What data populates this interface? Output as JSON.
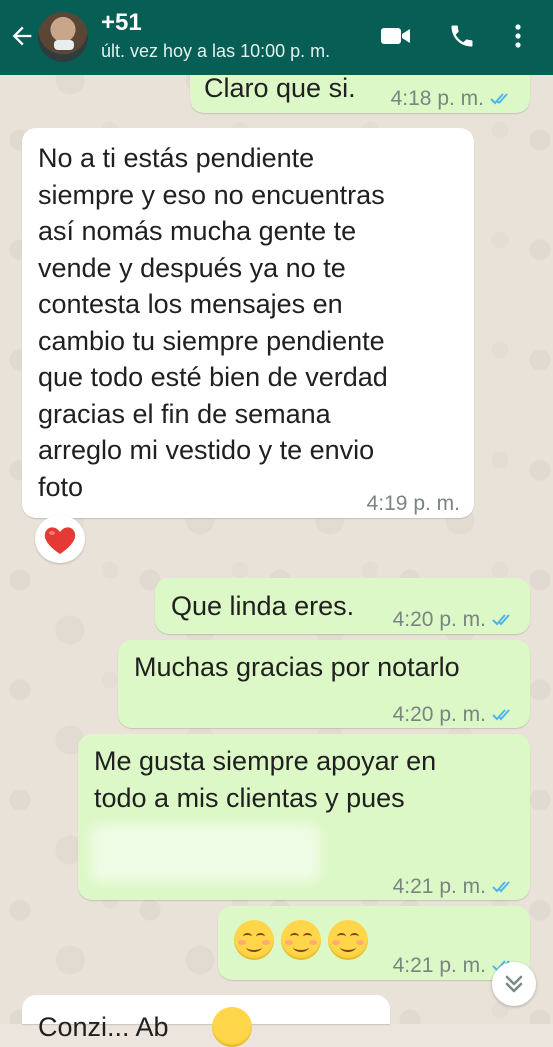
{
  "header": {
    "contact_name": "+51",
    "last_seen": "últ. vez hoy a las 10:00 p. m.",
    "background": "#075e54",
    "icons": [
      "back-arrow-icon",
      "video-call-icon",
      "phone-call-icon",
      "more-options-icon"
    ]
  },
  "messages": [
    {
      "direction": "out",
      "text": "Claro que si.",
      "time": "4:18 p. m.",
      "status": "read"
    },
    {
      "direction": "in",
      "text": "No a ti estás pendiente\nsiempre y eso no encuentras\nasí nomás mucha gente te\nvende y después ya no te\ncontesta los mensajes en\ncambio tu siempre pendiente\nque todo esté bien de verdad\ngracias el fin de semana\narreglo mi vestido y te envio\nfoto",
      "time": "4:19 p. m.",
      "reaction": "red-heart"
    },
    {
      "direction": "out",
      "text": "Que linda eres.",
      "time": "4:20 p. m.",
      "status": "read"
    },
    {
      "direction": "out",
      "text": "Muchas gracias por notarlo",
      "time": "4:20 p. m.",
      "status": "read"
    },
    {
      "direction": "out",
      "text": "Me gusta siempre apoyar en\ntodo a mis clientas y pues",
      "time": "4:21 p. m.",
      "status": "read",
      "has_blurred_text": true
    },
    {
      "direction": "out",
      "emoji": [
        "smiling-face-icon",
        "smiling-face-icon",
        "smiling-face-icon"
      ],
      "time": "4:21 p. m.",
      "status": "read"
    },
    {
      "direction": "in",
      "text": "Conzi... Ab",
      "partial": true
    }
  ],
  "colors": {
    "outgoing_bubble": "#dcf8c6",
    "incoming_bubble": "#ffffff",
    "read_ticks": "#4fb6ec",
    "chat_background": "#ece5dd"
  },
  "scroll_button_icon": "chevron-double-down-icon"
}
